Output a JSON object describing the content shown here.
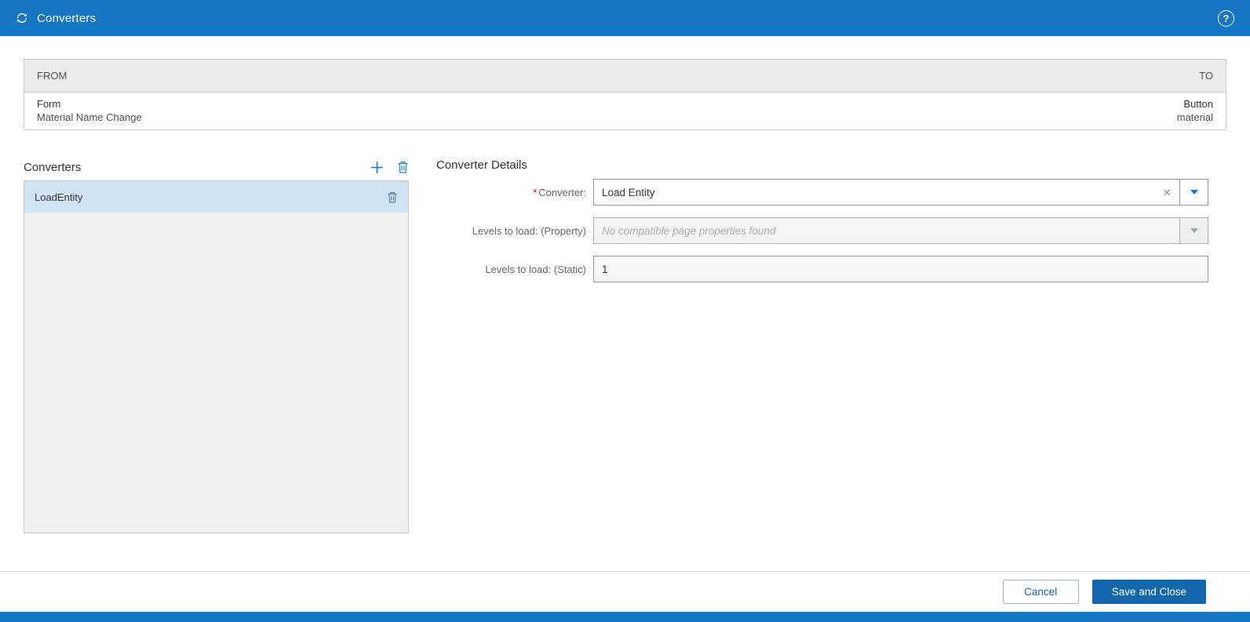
{
  "header": {
    "title": "Converters",
    "help_glyph": "?"
  },
  "mapping_table": {
    "from_header": "FROM",
    "to_header": "TO",
    "row": {
      "from_type": "Form",
      "from_name": "Material Name Change",
      "to_type": "Button",
      "to_name": "material"
    }
  },
  "converters_panel": {
    "title": "Converters",
    "items": [
      {
        "label": "LoadEntity",
        "selected": true
      }
    ]
  },
  "details_panel": {
    "title": "Converter Details",
    "fields": [
      {
        "label": "Converter:",
        "required_marker": "*",
        "value": "Load Entity",
        "clear_glyph": "×"
      },
      {
        "label": "Levels to load: (Property)",
        "value": "",
        "placeholder": "No compatible page properties found",
        "disabled": true
      },
      {
        "label": "Levels to load: (Static)",
        "value": "1"
      }
    ]
  },
  "footer": {
    "cancel_label": "Cancel",
    "save_label": "Save and Close"
  },
  "colors": {
    "header_blue": "#1576c6",
    "primary_button_blue": "#1567ad",
    "selected_item_blue": "#cfe3f5",
    "required_red": "#c00000",
    "table_header_gray": "#ebebeb",
    "list_background_gray": "#edeff0"
  }
}
